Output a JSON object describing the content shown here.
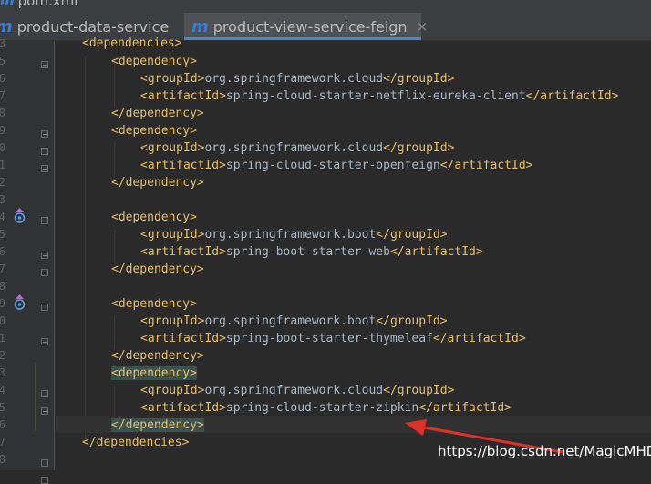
{
  "top_file_label": "pom.xml",
  "tabs": [
    {
      "icon_letter": "m",
      "label": "product-data-service",
      "active": false
    },
    {
      "icon_letter": "m",
      "label": "product-view-service-feign",
      "active": true,
      "close": "×"
    }
  ],
  "line_numbers": [
    "3",
    "5",
    "6",
    "7",
    "8",
    "9",
    "0",
    "1",
    "2",
    "3",
    "4",
    "5",
    "6",
    "7",
    "8",
    "9",
    "0",
    "1",
    "2",
    "3",
    "4",
    "5",
    "6",
    "7",
    "8",
    "9"
  ],
  "code": {
    "l0": {
      "open": "<dependencies>"
    },
    "l1": {
      "open": "<dependency>"
    },
    "l2": {
      "open": "<groupId>",
      "text": "org.springframework.cloud",
      "close": "</groupId>"
    },
    "l3": {
      "open": "<artifactId>",
      "text": "spring-cloud-starter-netflix-eureka-client",
      "close": "</artifactId>"
    },
    "l4": {
      "close": "</dependency>"
    },
    "l5": {
      "open": "<dependency>"
    },
    "l6": {
      "open": "<groupId>",
      "text": "org.springframework.cloud",
      "close": "</groupId>"
    },
    "l7": {
      "open": "<artifactId>",
      "text": "spring-cloud-starter-openfeign",
      "close": "</artifactId>"
    },
    "l8": {
      "close": "</dependency>"
    },
    "l10": {
      "open": "<dependency>"
    },
    "l11": {
      "open": "<groupId>",
      "text": "org.springframework.boot",
      "close": "</groupId>"
    },
    "l12": {
      "open": "<artifactId>",
      "text": "spring-boot-starter-web",
      "close": "</artifactId>"
    },
    "l13": {
      "close": "</dependency>"
    },
    "l15": {
      "open": "<dependency>"
    },
    "l16": {
      "open": "<groupId>",
      "text": "org.springframework.boot",
      "close": "</groupId>"
    },
    "l17": {
      "open": "<artifactId>",
      "text": "spring-boot-starter-thymeleaf",
      "close": "</artifactId>"
    },
    "l18": {
      "close": "</dependency>"
    },
    "l19": {
      "open": "<dependency>"
    },
    "l20": {
      "open": "<groupId>",
      "text": "org.springframework.cloud",
      "close": "</groupId>"
    },
    "l21": {
      "open": "<artifactId>",
      "text": "spring-cloud-starter-zipkin",
      "close": "</artifactId>"
    },
    "l22": {
      "close": "</dependency>"
    },
    "l23": {
      "close": "</dependencies>"
    }
  },
  "watermark": "https://blog.csdn.net/MagicMHD",
  "colors": {
    "tag": "#e8bf6a",
    "text": "#a9b7c6",
    "arrow": "#e0302a",
    "match_highlight": "#3b514d"
  }
}
